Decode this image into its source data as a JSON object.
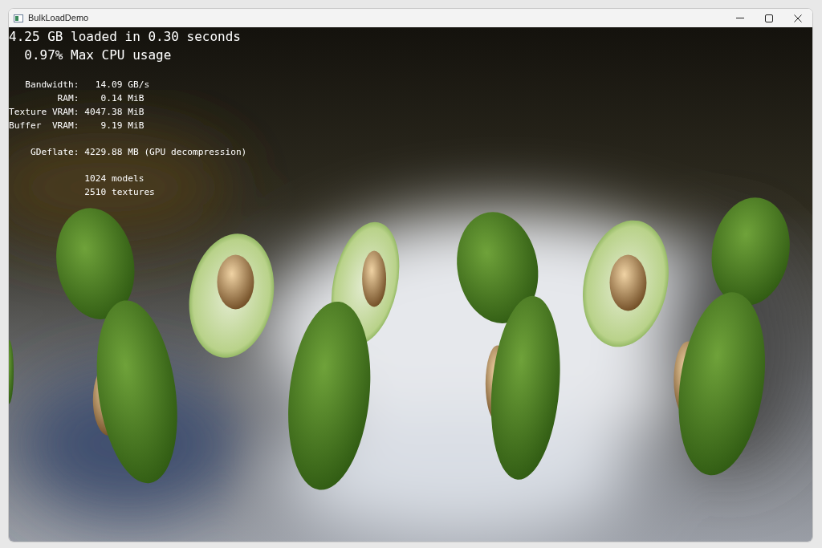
{
  "window": {
    "title": "BulkLoadDemo"
  },
  "overlay": {
    "headline": [
      "4.25 GB loaded in 0.30 seconds",
      "  0.97% Max CPU usage"
    ],
    "stat_groups": [
      [
        "   Bandwidth:   14.09 GB/s",
        "         RAM:    0.14 MiB",
        "Texture VRAM: 4047.38 MiB",
        "Buffer  VRAM:    9.19 MiB"
      ],
      [
        "    GDeflate: 4229.88 MB (GPU decompression)"
      ],
      [
        "              1024 models",
        "              2510 textures"
      ]
    ]
  }
}
